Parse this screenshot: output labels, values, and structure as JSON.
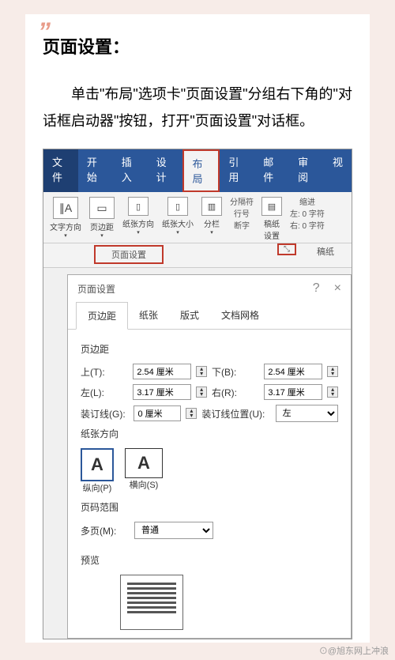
{
  "article": {
    "title": "页面设置：",
    "text": "单击\"布局\"选项卡\"页面设置\"分组右下角的\"对话框启动器\"按钮，打开\"页面设置\"对话框。"
  },
  "ribbon": {
    "tabs": [
      "文件",
      "开始",
      "插入",
      "设计",
      "布局",
      "引用",
      "邮件",
      "审阅",
      "视"
    ]
  },
  "toolbar": {
    "textDirection": "文字方向",
    "margins": "页边距",
    "orientation": "纸张方向",
    "size": "纸张大小",
    "columns": "分栏",
    "breaks": "分隔符",
    "lineNumbers": "行号",
    "hyphenation": "断字",
    "manuscript": "稿纸\n设置",
    "indent": "缩进",
    "indentLeft": "左: 0 字符",
    "indentRight": "右: 0 字符",
    "groupName": "页面设置",
    "launcher": "⤡",
    "manuscriptGroup": "稿纸"
  },
  "dialog": {
    "title": "页面设置",
    "help": "?",
    "close": "×",
    "tabs": [
      "页边距",
      "纸张",
      "版式",
      "文档网格"
    ],
    "marginsSection": "页边距",
    "top": "上(T):",
    "topVal": "2.54 厘米",
    "bottom": "下(B):",
    "bottomVal": "2.54 厘米",
    "left": "左(L):",
    "leftVal": "3.17 厘米",
    "right": "右(R):",
    "rightVal": "3.17 厘米",
    "gutter": "装订线(G):",
    "gutterVal": "0 厘米",
    "gutterPos": "装订线位置(U):",
    "gutterPosVal": "左",
    "orientationSection": "纸张方向",
    "portrait": "纵向(P)",
    "landscape": "横向(S)",
    "pagesSection": "页码范围",
    "multiPage": "多页(M):",
    "multiPageVal": "普通",
    "previewSection": "预览"
  },
  "watermark": "⊙@旭东网上冲浪"
}
